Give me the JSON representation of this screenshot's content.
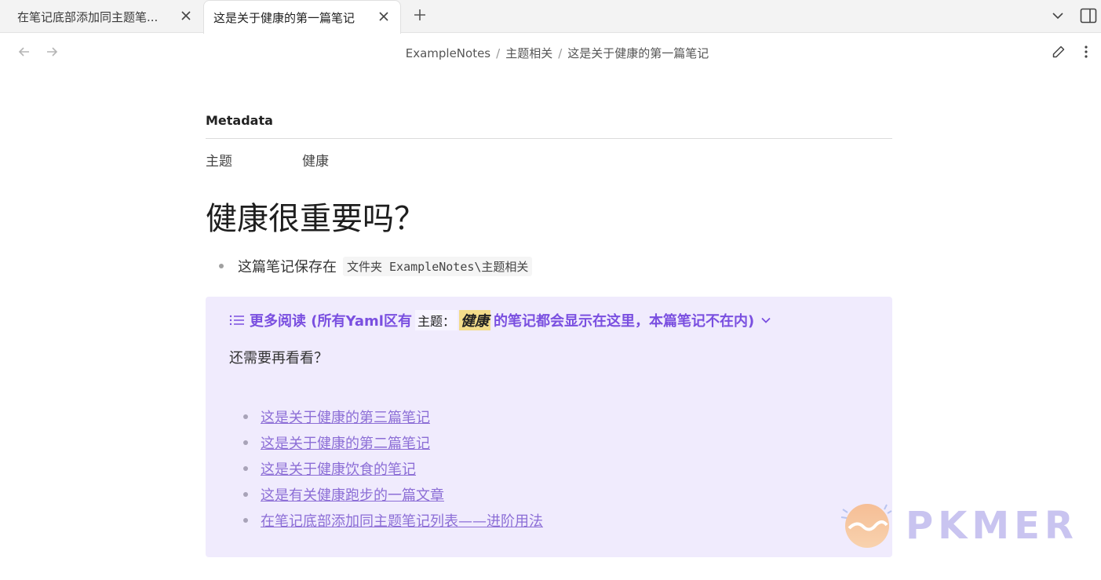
{
  "tabs": [
    {
      "title": "在笔记底部添加同主题笔...",
      "active": false
    },
    {
      "title": "这是关于健康的第一篇笔记",
      "active": true
    }
  ],
  "breadcrumb": [
    "ExampleNotes",
    "主题相关",
    "这是关于健康的第一篇笔记"
  ],
  "metadata": {
    "heading": "Metadata",
    "key": "主题",
    "value": "健康"
  },
  "note": {
    "title": "健康很重要吗？",
    "bullet_text": "这篇笔记保存在",
    "bullet_code": "文件夹 ExampleNotes\\主题相关"
  },
  "callout": {
    "title_prefix": "更多阅读 (所有Yaml区有",
    "title_code": "主题：",
    "title_highlight": "健康",
    "title_suffix": "的笔记都会显示在这里，本篇笔记不在内)",
    "body": "还需要再看看？",
    "links": [
      "这是关于健康的第三篇笔记",
      "这是关于健康的第二篇笔记",
      "这是关于健康饮食的笔记",
      "这是有关健康跑步的一篇文章",
      "在笔记底部添加同主题笔记列表——进阶用法"
    ]
  },
  "watermark": {
    "text": "PKMER"
  },
  "icons": {
    "tab_close": "close-icon",
    "new_tab": "plus-icon",
    "tab_list": "chevron-down-icon",
    "sidebar": "sidebar-toggle-icon",
    "back": "arrow-left-icon",
    "forward": "arrow-right-icon",
    "edit": "pencil-icon",
    "more": "more-vertical-icon",
    "callout": "list-icon"
  },
  "colors": {
    "callout_bg": "#f0ebfd",
    "callout_accent": "#7a4fe0",
    "link": "#8c6ed6",
    "highlight": "#f3dc8a"
  }
}
